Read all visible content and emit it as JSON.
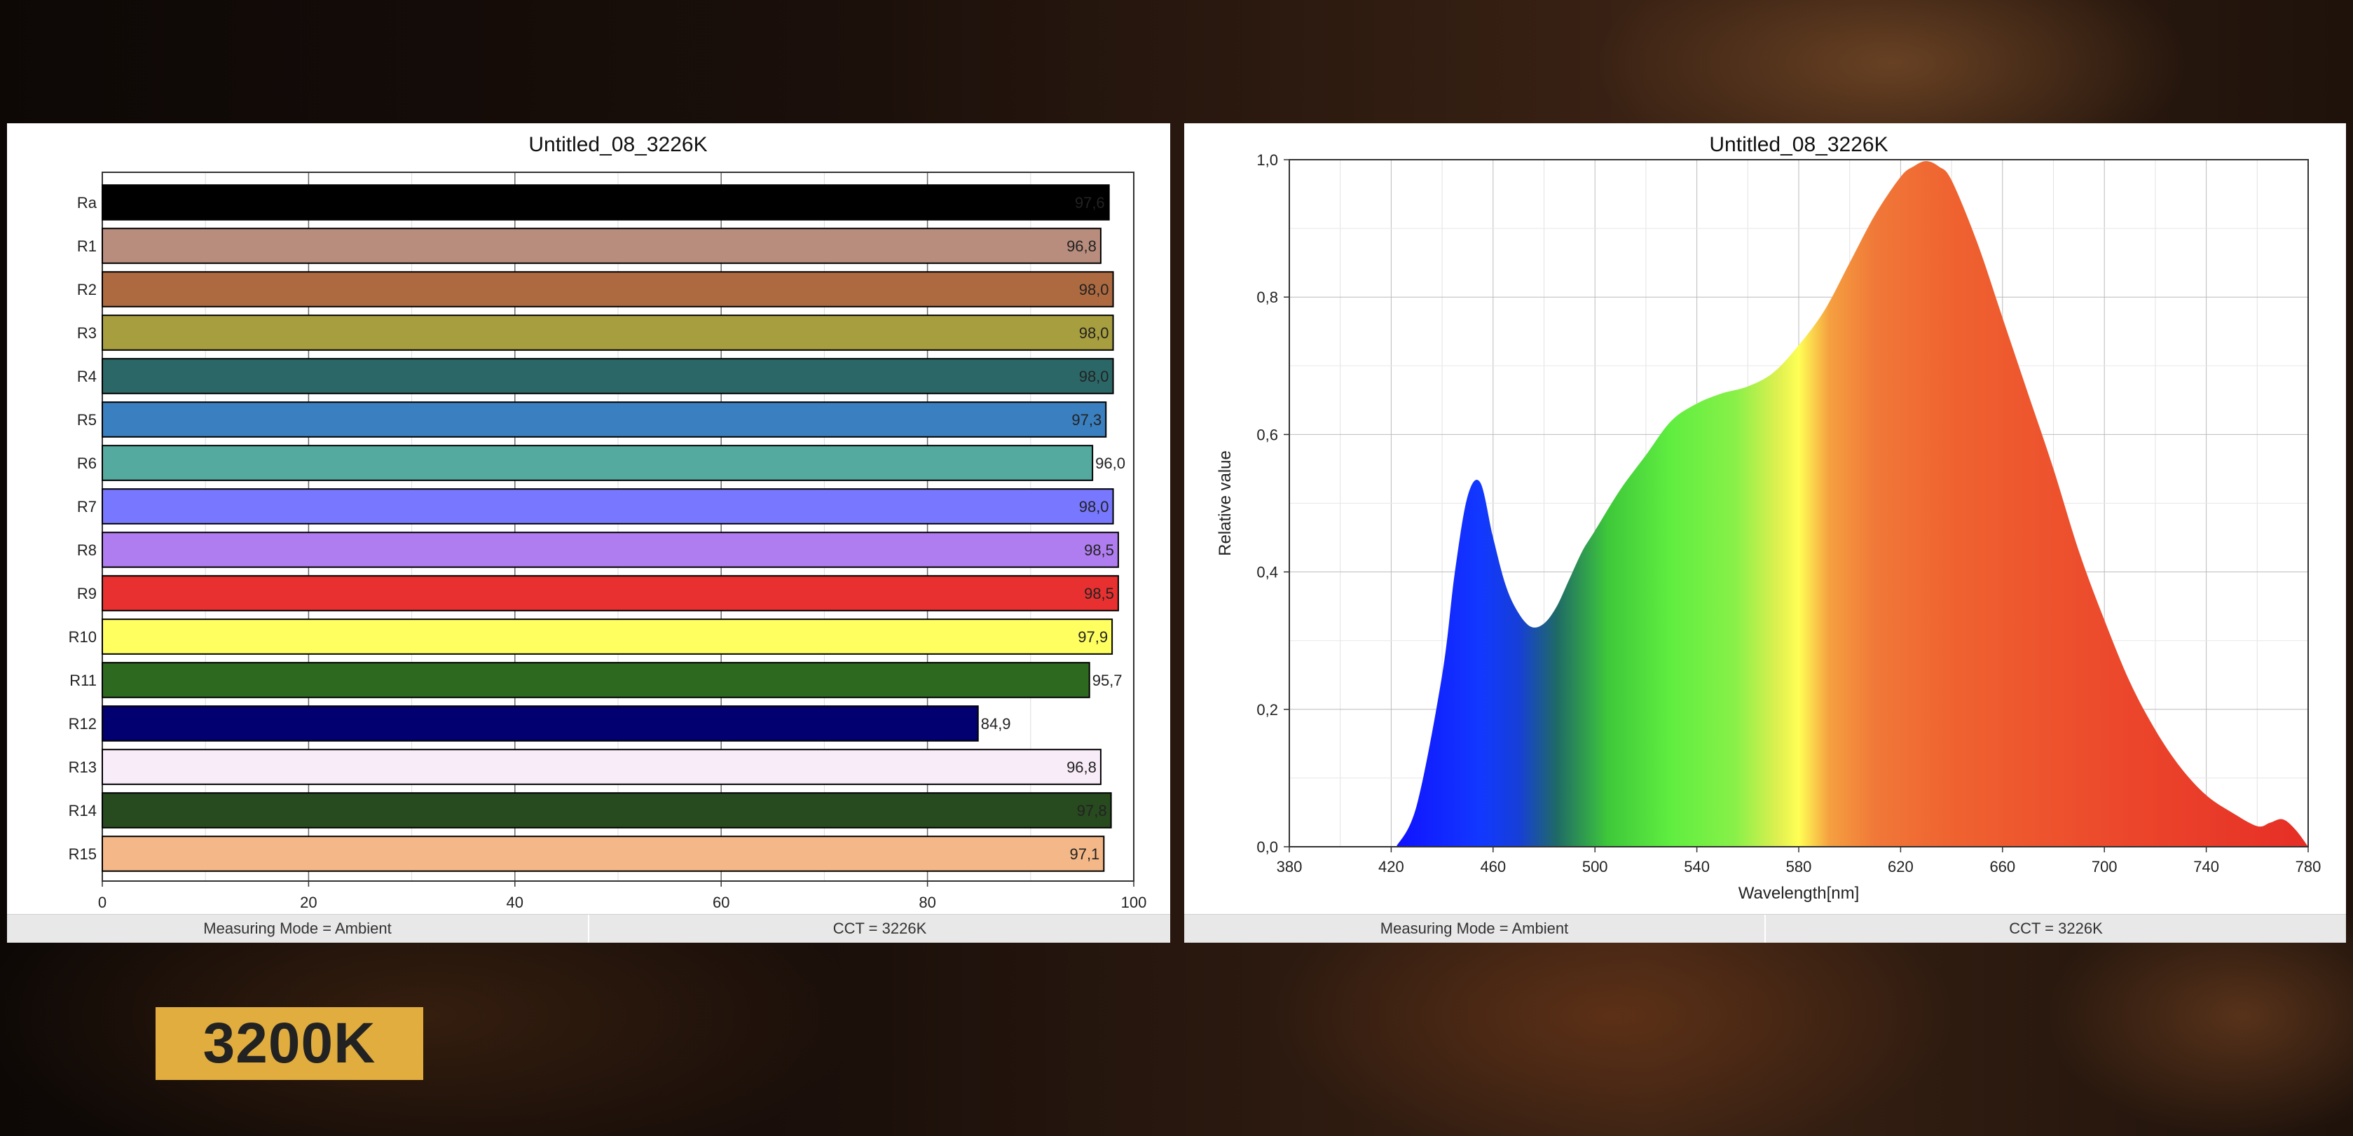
{
  "badge": "3200K",
  "left_panel": {
    "status": [
      "Measuring Mode = Ambient",
      "CCT = 3226K"
    ]
  },
  "right_panel": {
    "status": [
      "Measuring Mode = Ambient",
      "CCT = 3226K"
    ]
  },
  "chart_data": [
    {
      "type": "bar",
      "orientation": "horizontal",
      "title": "Untitled_08_3226K",
      "xlim": [
        0,
        100
      ],
      "xticks": [
        "0",
        "20",
        "40",
        "60",
        "80",
        "100"
      ],
      "categories": [
        "Ra",
        "R1",
        "R2",
        "R3",
        "R4",
        "R5",
        "R6",
        "R7",
        "R8",
        "R9",
        "R10",
        "R11",
        "R12",
        "R13",
        "R14",
        "R15"
      ],
      "values": [
        97.6,
        96.8,
        98.0,
        98.0,
        98.0,
        97.3,
        96.0,
        98.0,
        98.5,
        98.5,
        97.9,
        95.7,
        84.9,
        96.8,
        97.8,
        97.1
      ],
      "value_labels": [
        "97,6",
        "96,8",
        "98,0",
        "98,0",
        "98,0",
        "97,3",
        "96,0",
        "98,0",
        "98,5",
        "98,5",
        "97,9",
        "95,7",
        "84,9",
        "96,8",
        "97,8",
        "97,1"
      ],
      "colors": [
        "#000000",
        "#b98d7e",
        "#ad6a40",
        "#a79e3f",
        "#2b6767",
        "#3a7fbf",
        "#55aaa0",
        "#7777ff",
        "#b07df0",
        "#e83030",
        "#ffff60",
        "#2d6a1f",
        "#020070",
        "#f8ecf8",
        "#284a1f",
        "#f4b888"
      ],
      "grid": true
    },
    {
      "type": "area",
      "title": "Untitled_08_3226K",
      "xlabel": "Wavelength[nm]",
      "ylabel": "Relative value",
      "xlim": [
        380,
        780
      ],
      "ylim": [
        0,
        1
      ],
      "xticks": [
        "380",
        "420",
        "460",
        "500",
        "540",
        "580",
        "620",
        "660",
        "700",
        "740",
        "780"
      ],
      "yticks": [
        "0,0",
        "0,2",
        "0,4",
        "0,6",
        "0,8",
        "1,0"
      ],
      "grid": true,
      "x": [
        422,
        430,
        440,
        445,
        450,
        455,
        460,
        465,
        470,
        475,
        480,
        485,
        490,
        495,
        500,
        510,
        520,
        530,
        540,
        550,
        560,
        570,
        580,
        590,
        600,
        610,
        620,
        625,
        630,
        635,
        640,
        650,
        660,
        670,
        680,
        690,
        700,
        710,
        720,
        730,
        740,
        750,
        760,
        765,
        770,
        775,
        780
      ],
      "y": [
        0.0,
        0.06,
        0.25,
        0.4,
        0.51,
        0.53,
        0.45,
        0.38,
        0.34,
        0.32,
        0.325,
        0.35,
        0.39,
        0.43,
        0.46,
        0.52,
        0.57,
        0.62,
        0.645,
        0.66,
        0.67,
        0.69,
        0.73,
        0.78,
        0.85,
        0.92,
        0.975,
        0.99,
        0.998,
        0.99,
        0.97,
        0.88,
        0.77,
        0.66,
        0.55,
        0.43,
        0.33,
        0.24,
        0.17,
        0.115,
        0.075,
        0.05,
        0.03,
        0.035,
        0.04,
        0.025,
        0.0
      ]
    }
  ]
}
